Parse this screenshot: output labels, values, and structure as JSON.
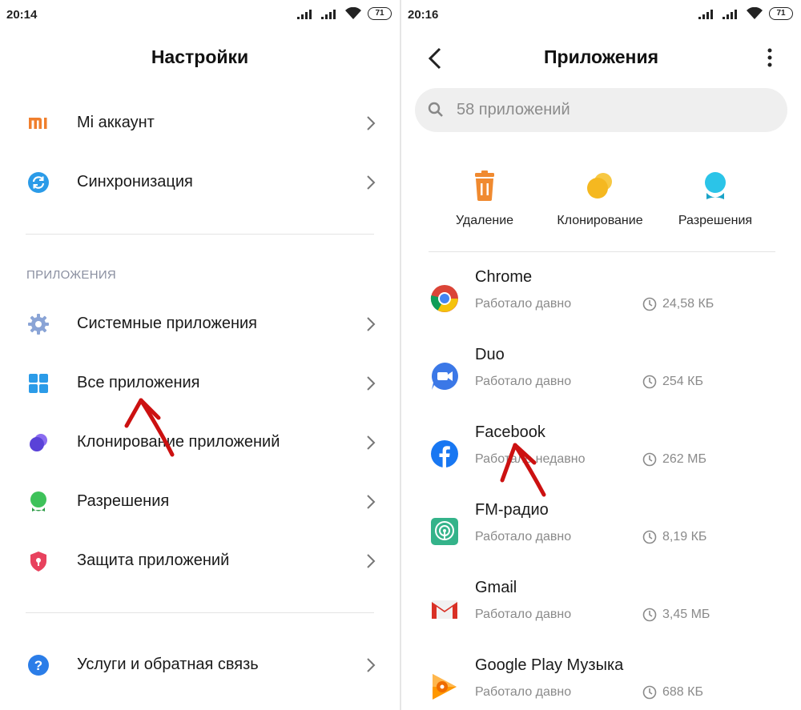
{
  "left": {
    "status_time": "20:14",
    "battery": "71",
    "title": "Настройки",
    "account_items": [
      {
        "label": "Mi аккаунт",
        "icon": "mi-logo-icon"
      },
      {
        "label": "Синхронизация",
        "icon": "sync-icon"
      }
    ],
    "section_label": "ПРИЛОЖЕНИЯ",
    "app_items": [
      {
        "label": "Системные приложения",
        "icon": "gear-icon"
      },
      {
        "label": "Все приложения",
        "icon": "grid-icon"
      },
      {
        "label": "Клонирование приложений",
        "icon": "clone-icon"
      },
      {
        "label": "Разрешения",
        "icon": "permissions-icon"
      },
      {
        "label": "Защита приложений",
        "icon": "shield-icon"
      }
    ],
    "footer_items": [
      {
        "label": "Услуги и обратная связь",
        "icon": "help-icon"
      }
    ]
  },
  "right": {
    "status_time": "20:16",
    "battery": "71",
    "title": "Приложения",
    "search_placeholder": "58 приложений",
    "actions": [
      {
        "label": "Удаление",
        "icon": "trash-icon",
        "color": "#f08a30"
      },
      {
        "label": "Клонирование",
        "icon": "clone-icon",
        "color": "#f5b820"
      },
      {
        "label": "Разрешения",
        "icon": "permissions-icon",
        "color": "#2bc4e8"
      }
    ],
    "apps": [
      {
        "name": "Chrome",
        "status": "Работало давно",
        "size": "24,58 КБ",
        "icon": "chrome-icon"
      },
      {
        "name": "Duo",
        "status": "Работало давно",
        "size": "254 КБ",
        "icon": "duo-icon"
      },
      {
        "name": "Facebook",
        "status": "Работало недавно",
        "size": "262 МБ",
        "icon": "facebook-icon"
      },
      {
        "name": "FM-радио",
        "status": "Работало давно",
        "size": "8,19 КБ",
        "icon": "fm-radio-icon"
      },
      {
        "name": "Gmail",
        "status": "Работало давно",
        "size": "3,45 МБ",
        "icon": "gmail-icon"
      },
      {
        "name": "Google Play Музыка",
        "status": "Работало давно",
        "size": "688 КБ",
        "icon": "play-music-icon"
      }
    ]
  },
  "colors": {
    "accent_arrow": "#cc1111",
    "mi_orange": "#f07f2d",
    "sync_blue": "#2b9be8",
    "text_secondary": "#8a8a8a"
  }
}
